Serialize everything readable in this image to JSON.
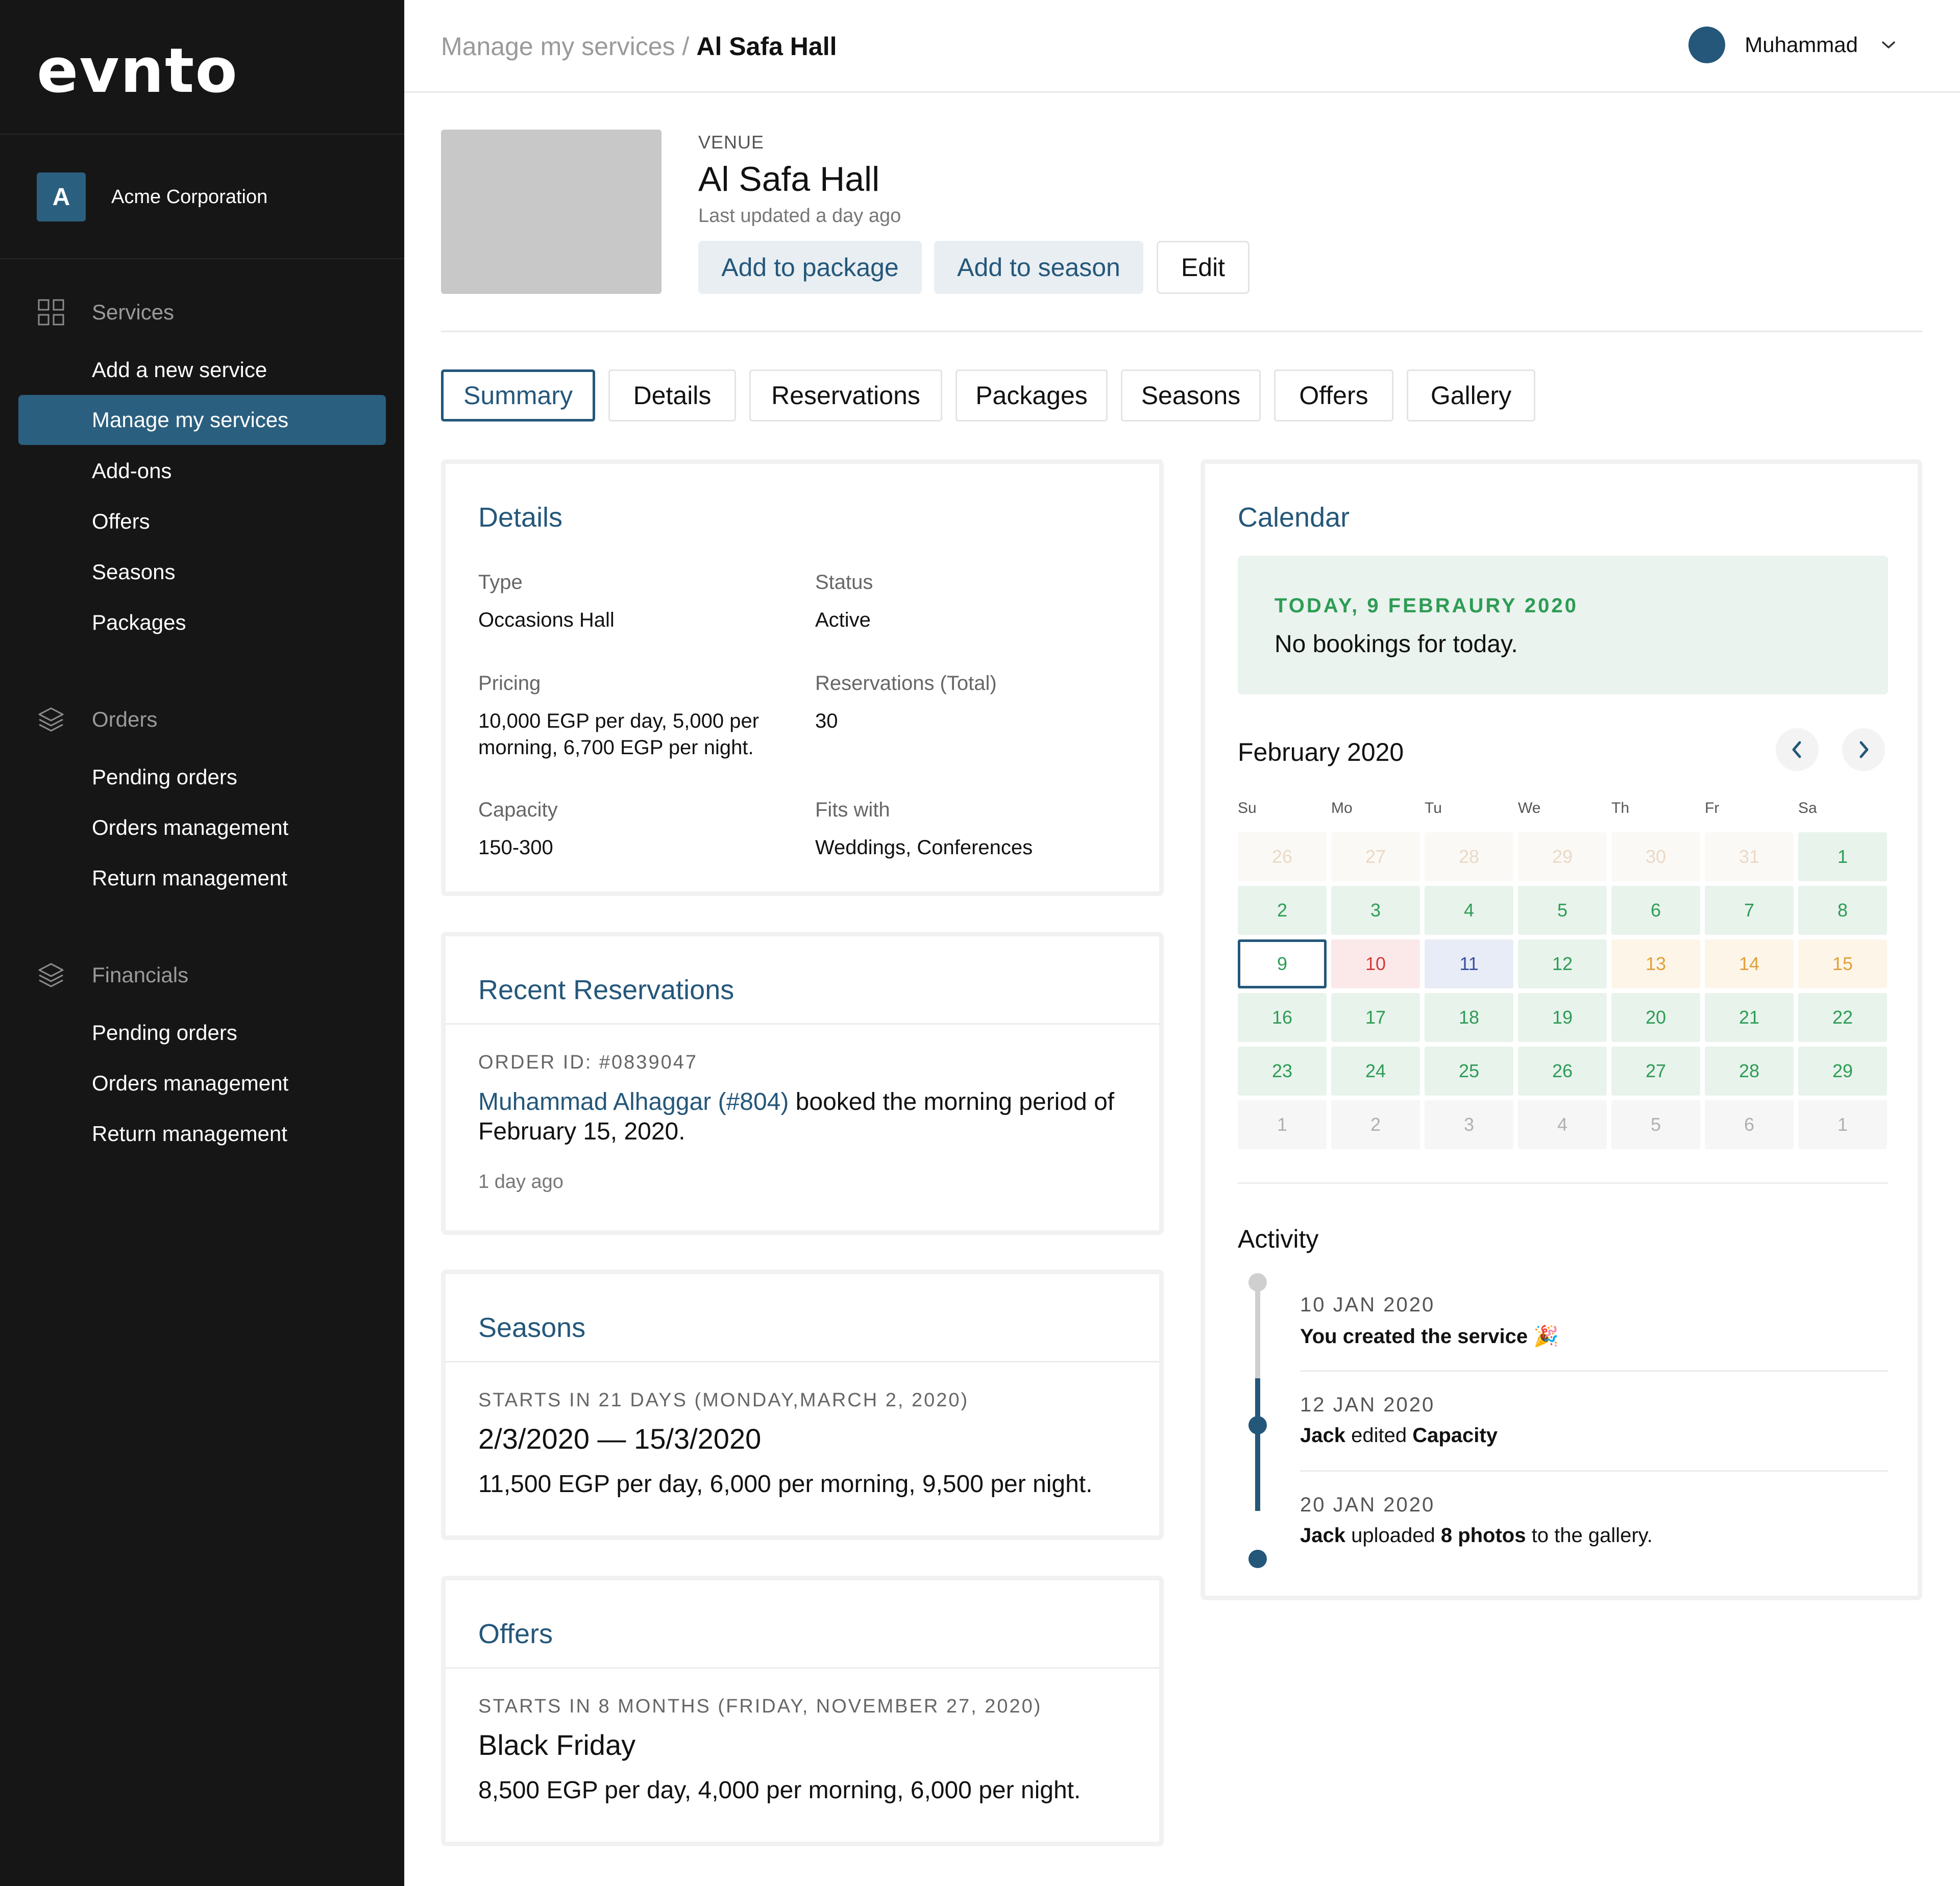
{
  "sidebar": {
    "logo": "evnto",
    "org": {
      "initial": "A",
      "name": "Acme Corporation"
    },
    "services": {
      "label": "Services",
      "items": [
        "Add a new service",
        "Manage my services",
        "Add-ons",
        "Offers",
        "Seasons",
        "Packages"
      ],
      "active_index": 1
    },
    "orders": {
      "label": "Orders",
      "items": [
        "Pending orders",
        "Orders management",
        "Return management"
      ]
    },
    "financials": {
      "label": "Financials",
      "items": [
        "Pending orders",
        "Orders management",
        "Return management"
      ]
    }
  },
  "topbar": {
    "breadcrumb_parent": "Manage my services",
    "breadcrumb_sep": "/",
    "breadcrumb_current": "Al Safa Hall",
    "user_name": "Muhammad"
  },
  "venue": {
    "label": "VENUE",
    "title": "Al Safa Hall",
    "updated": "Last updated a day ago",
    "buttons": {
      "add_package": "Add to package",
      "add_season": "Add to season",
      "edit": "Edit"
    }
  },
  "tabs": [
    "Summary",
    "Details",
    "Reservations",
    "Packages",
    "Seasons",
    "Offers",
    "Gallery"
  ],
  "details": {
    "title": "Details",
    "type_label": "Type",
    "type_value": "Occasions Hall",
    "status_label": "Status",
    "status_value": "Active",
    "pricing_label": "Pricing",
    "pricing_value": "10,000 EGP per day, 5,000 per morning, 6,700 EGP per night.",
    "reservations_label": "Reservations (Total)",
    "reservations_value": "30",
    "capacity_label": "Capacity",
    "capacity_value": "150-300",
    "fits_label": "Fits with",
    "fits_value": "Weddings, Conferences"
  },
  "recent": {
    "title": "Recent Reservations",
    "order_id": "ORDER ID: #0839047",
    "customer": "Muhammad Alhaggar (#804)",
    "text": " booked the morning period of February 15, 2020.",
    "time": "1 day ago"
  },
  "seasons": {
    "title": "Seasons",
    "meta": "STARTS IN 21 DAYS (MONDAY,MARCH 2, 2020)",
    "range": "2/3/2020 — 15/3/2020",
    "price": "11,500 EGP per day, 6,000 per morning, 9,500 per night."
  },
  "offers": {
    "title": "Offers",
    "meta": "STARTS IN 8 MONTHS (FRIDAY, NOVEMBER 27, 2020)",
    "name": "Black Friday",
    "price": "8,500 EGP per day, 4,000 per morning, 6,000 per night."
  },
  "calendar": {
    "title": "Calendar",
    "today_label": "TODAY,  9 FEBRAURY 2020",
    "today_msg": "No bookings for today.",
    "month": "February 2020",
    "weekdays": [
      "Su",
      "Mo",
      "Tu",
      "We",
      "Th",
      "Fr",
      "Sa"
    ],
    "weeks": [
      [
        [
          "26",
          "ghost"
        ],
        [
          "27",
          "ghost"
        ],
        [
          "28",
          "ghost"
        ],
        [
          "29",
          "ghost"
        ],
        [
          "30",
          "ghost"
        ],
        [
          "31",
          "ghost"
        ],
        [
          "1",
          "avail"
        ]
      ],
      [
        [
          "2",
          "avail"
        ],
        [
          "3",
          "avail"
        ],
        [
          "4",
          "avail"
        ],
        [
          "5",
          "avail"
        ],
        [
          "6",
          "avail"
        ],
        [
          "7",
          "avail"
        ],
        [
          "8",
          "avail"
        ]
      ],
      [
        [
          "9",
          "today"
        ],
        [
          "10",
          "booked"
        ],
        [
          "11",
          "blue"
        ],
        [
          "12",
          "avail"
        ],
        [
          "13",
          "partial"
        ],
        [
          "14",
          "partial"
        ],
        [
          "15",
          "partial"
        ]
      ],
      [
        [
          "16",
          "avail"
        ],
        [
          "17",
          "avail"
        ],
        [
          "18",
          "avail"
        ],
        [
          "19",
          "avail"
        ],
        [
          "20",
          "avail"
        ],
        [
          "21",
          "avail"
        ],
        [
          "22",
          "avail"
        ]
      ],
      [
        [
          "23",
          "avail"
        ],
        [
          "24",
          "avail"
        ],
        [
          "25",
          "avail"
        ],
        [
          "26",
          "avail"
        ],
        [
          "27",
          "avail"
        ],
        [
          "28",
          "avail"
        ],
        [
          "29",
          "avail"
        ]
      ],
      [
        [
          "1",
          "next"
        ],
        [
          "2",
          "next"
        ],
        [
          "3",
          "next"
        ],
        [
          "4",
          "next"
        ],
        [
          "5",
          "next"
        ],
        [
          "6",
          "next"
        ],
        [
          "1",
          "next"
        ]
      ]
    ]
  },
  "activity": {
    "title": "Activity",
    "items": [
      {
        "date": "10 JAN 2020",
        "parts": [
          [
            "You created the service",
            true
          ],
          [
            " 🎉",
            false
          ]
        ]
      },
      {
        "date": "12 JAN 2020",
        "parts": [
          [
            "Jack",
            true
          ],
          [
            " edited ",
            false
          ],
          [
            "Capacity",
            true
          ]
        ]
      },
      {
        "date": "20 JAN 2020",
        "parts": [
          [
            "Jack",
            true
          ],
          [
            " uploaded ",
            false
          ],
          [
            "8 photos",
            true
          ],
          [
            " to the gallery.",
            false
          ]
        ]
      }
    ]
  },
  "colors": {
    "sidebar_bg": "#161616",
    "accent": "#24577a",
    "available": "#2e9c55",
    "booked": "#d13b3b",
    "partial": "#e0a03a"
  }
}
